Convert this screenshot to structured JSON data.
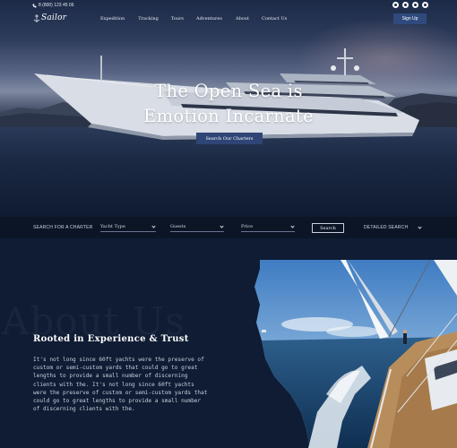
{
  "topbar": {
    "phone": "8 (800) 123 45 06",
    "socials": [
      "facebook-icon",
      "twitter-icon",
      "instagram-icon",
      "youtube-icon"
    ]
  },
  "nav": {
    "logo_text": "Sailor",
    "items": [
      "Expedition",
      "Tracking",
      "Tours",
      "Adventures",
      "About",
      "Contact Us"
    ],
    "signup_label": "Sign Up"
  },
  "hero": {
    "title_line1": "The Open Sea is",
    "title_line2": "Emotion Incarnate",
    "cta_label": "Search Our Charters"
  },
  "search": {
    "label": "SEARCH FOR A CHARTER",
    "yacht_type": "Yacht Type",
    "guests": "Guests",
    "price": "Price",
    "button_label": "Search",
    "detailed_label": "DETAILED SEARCH"
  },
  "about": {
    "watermark": "About Us",
    "heading": "Rooted in Experience & Trust",
    "body": "It's not long since 60ft yachts were the preserve of custom or semi-custom yards that could go to great lengths to provide a small number of discerning clients with the. It's not long since 60ft yachts were the preserve of custom or semi-custom yards that could go to great lengths to provide a small number of discerning clients with the."
  },
  "colors": {
    "page_bg": "#0f1c33",
    "accent": "#2f4a7d",
    "searchbar_bg": "#0c1526"
  }
}
